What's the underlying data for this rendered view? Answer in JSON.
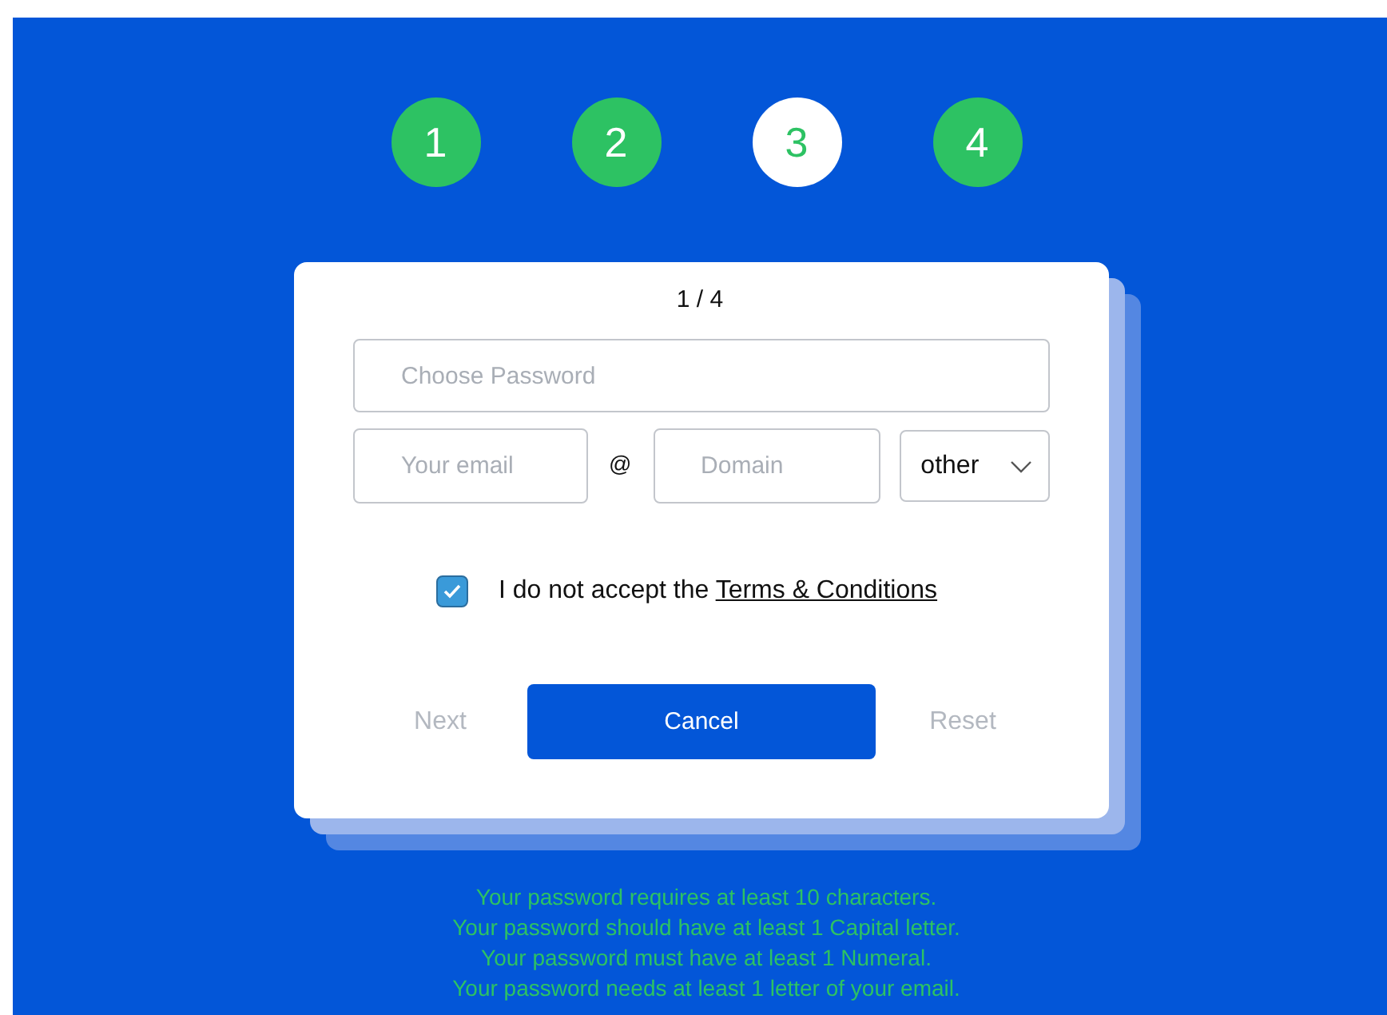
{
  "steps": [
    {
      "label": "1",
      "selected": false
    },
    {
      "label": "2",
      "selected": false
    },
    {
      "label": "3",
      "selected": true
    },
    {
      "label": "4",
      "selected": false
    }
  ],
  "card": {
    "page_counter": "1 / 4",
    "password_field": {
      "placeholder": "Choose Password"
    },
    "email_field": {
      "placeholder": "Your email"
    },
    "at_sign": "@",
    "domain_field": {
      "placeholder": "Domain"
    },
    "domain_select": {
      "value": "other"
    },
    "terms": {
      "checked": true,
      "text": "I do not accept the ",
      "link": "Terms & Conditions"
    },
    "buttons": [
      {
        "label": "Next",
        "kind": "text",
        "disabled": true
      },
      {
        "label": "Cancel",
        "kind": "primary",
        "disabled": false
      },
      {
        "label": "Reset",
        "kind": "text",
        "disabled": true
      }
    ]
  },
  "hints": [
    "Your password requires at least 10 characters.",
    "Your password should have at least 1 Capital letter.",
    "Your password must have at least 1 Numeral.",
    "Your password needs at least 1 letter of your email."
  ]
}
